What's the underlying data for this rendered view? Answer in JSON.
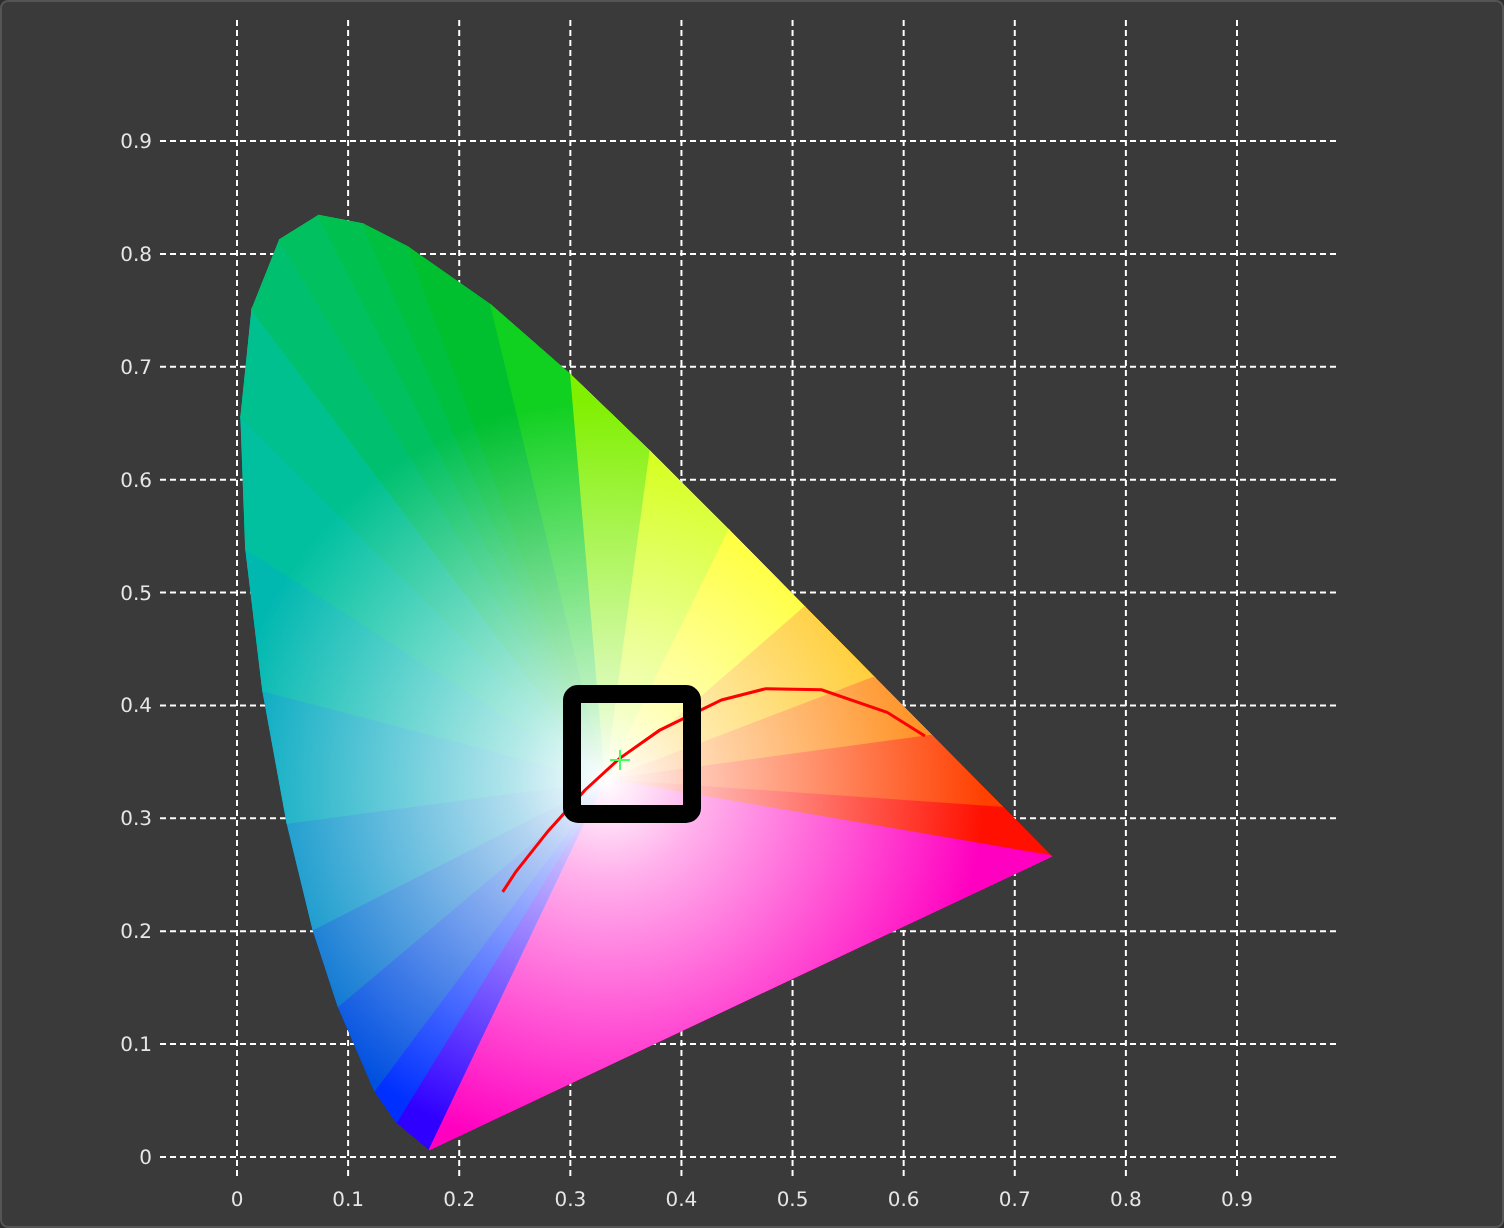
{
  "chart_data": {
    "type": "line",
    "grid": true,
    "xlim": [
      0,
      0.992
    ],
    "ylim": [
      0,
      0.9
    ],
    "xticks": [
      0,
      0.1,
      0.2,
      0.3,
      0.4,
      0.5,
      0.6,
      0.7,
      0.8,
      0.9
    ],
    "yticks": [
      0,
      0.1,
      0.2,
      0.3,
      0.4,
      0.5,
      0.6,
      0.7,
      0.8,
      0.9
    ],
    "x": [
      0.24,
      0.252,
      0.281,
      0.314,
      0.345,
      0.381,
      0.437,
      0.477,
      0.527,
      0.586,
      0.62
    ],
    "series": [
      {
        "color": "#ff0000",
        "values": [
          0.234,
          0.252,
          0.288,
          0.324,
          0.352,
          0.377,
          0.404,
          0.414,
          0.413,
          0.393,
          0.372
        ]
      }
    ]
  }
}
